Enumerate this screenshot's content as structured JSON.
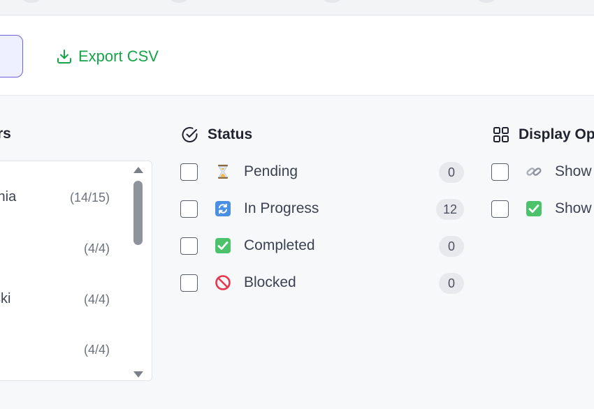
{
  "toolbar": {
    "export_label": "Export CSV"
  },
  "left_panel": {
    "title_fragment": "rs",
    "items": [
      {
        "name": "thia",
        "count": "(14/15)"
      },
      {
        "name": "",
        "count": "(4/4)"
      },
      {
        "name": "ski",
        "count": "(4/4)"
      },
      {
        "name": "",
        "count": "(4/4)"
      }
    ]
  },
  "status": {
    "title": "Status",
    "items": [
      {
        "label": "Pending",
        "count": "0",
        "icon": "hourglass-icon"
      },
      {
        "label": "In Progress",
        "count": "12",
        "icon": "refresh-icon"
      },
      {
        "label": "Completed",
        "count": "0",
        "icon": "check-mark-icon"
      },
      {
        "label": "Blocked",
        "count": "0",
        "icon": "prohibited-icon"
      }
    ]
  },
  "display_options": {
    "title": "Display Op",
    "items": [
      {
        "label": "Show",
        "icon": "link-icon"
      },
      {
        "label": "Show",
        "icon": "check-mark-icon"
      }
    ]
  },
  "colors": {
    "accent": "#16a34a",
    "selected_border": "#6c63d9"
  }
}
